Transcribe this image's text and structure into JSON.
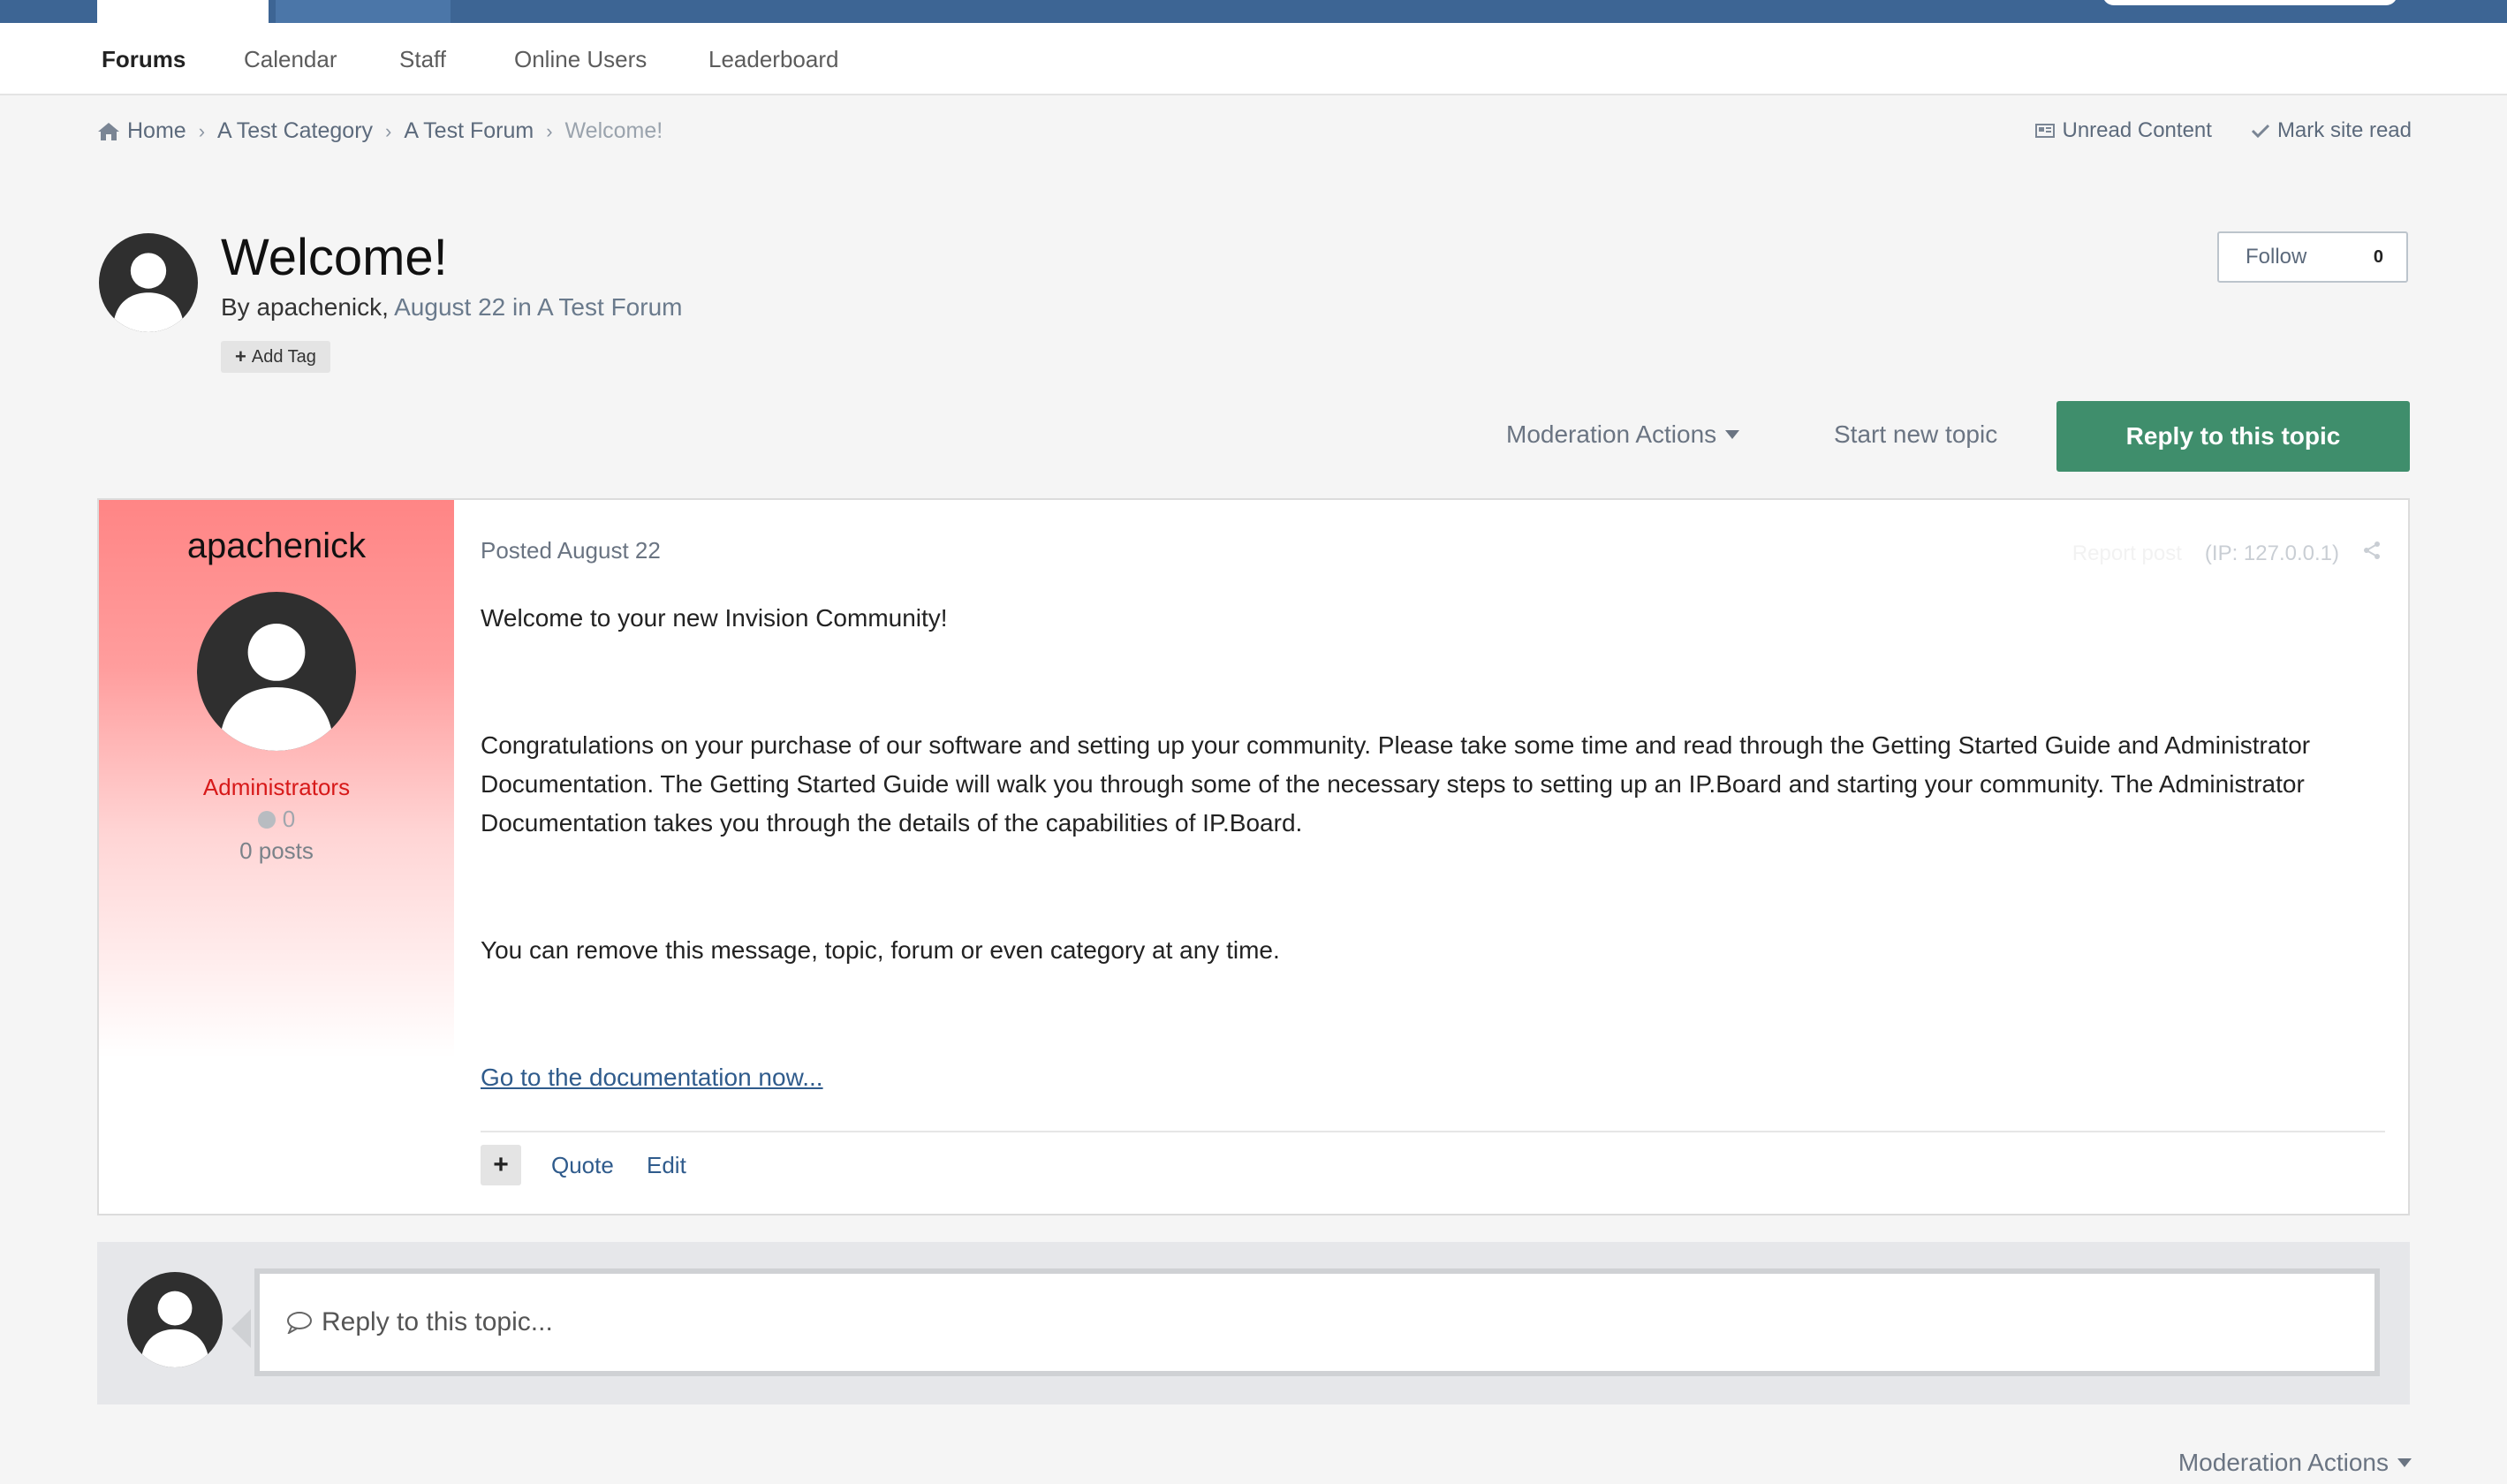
{
  "nav": {
    "tabs": [
      "Forums",
      "Calendar",
      "Staff",
      "Online Users",
      "Leaderboard"
    ]
  },
  "breadcrumb": {
    "items": [
      "Home",
      "A Test Category",
      "A Test Forum",
      "Welcome!"
    ]
  },
  "quick_links": {
    "unread": "Unread Content",
    "mark_read": "Mark site read"
  },
  "topic": {
    "title": "Welcome!",
    "by_prefix": "By apachenick,",
    "date_forum": "August 22 in A Test Forum",
    "add_tag": "Add Tag",
    "follow_label": "Follow",
    "follow_count": "0"
  },
  "actions": {
    "moderation": "Moderation Actions",
    "start_topic": "Start new topic",
    "reply": "Reply to this topic"
  },
  "post": {
    "author": "apachenick",
    "group": "Administrators",
    "reputation": "0",
    "posts": "0 posts",
    "posted": "Posted August 22",
    "report": "Report post",
    "ip": "(IP: 127.0.0.1)",
    "paragraphs": [
      "Welcome to your new Invision Community!",
      "Congratulations on your purchase of our software and setting up your community. Please take some time and read through the Getting Started Guide and Administrator Documentation. The Getting Started Guide will walk you through some of the necessary steps to setting up an IP.Board and starting your community. The Administrator Documentation takes you through the details of the capabilities of IP.Board.",
      "You can remove this message, topic, forum or even category at any time."
    ],
    "doc_link": "Go to the documentation now...",
    "quote": "Quote",
    "edit": "Edit"
  },
  "reply_box": {
    "placeholder": "Reply to this topic..."
  },
  "footer": {
    "moderation": "Moderation Actions"
  }
}
